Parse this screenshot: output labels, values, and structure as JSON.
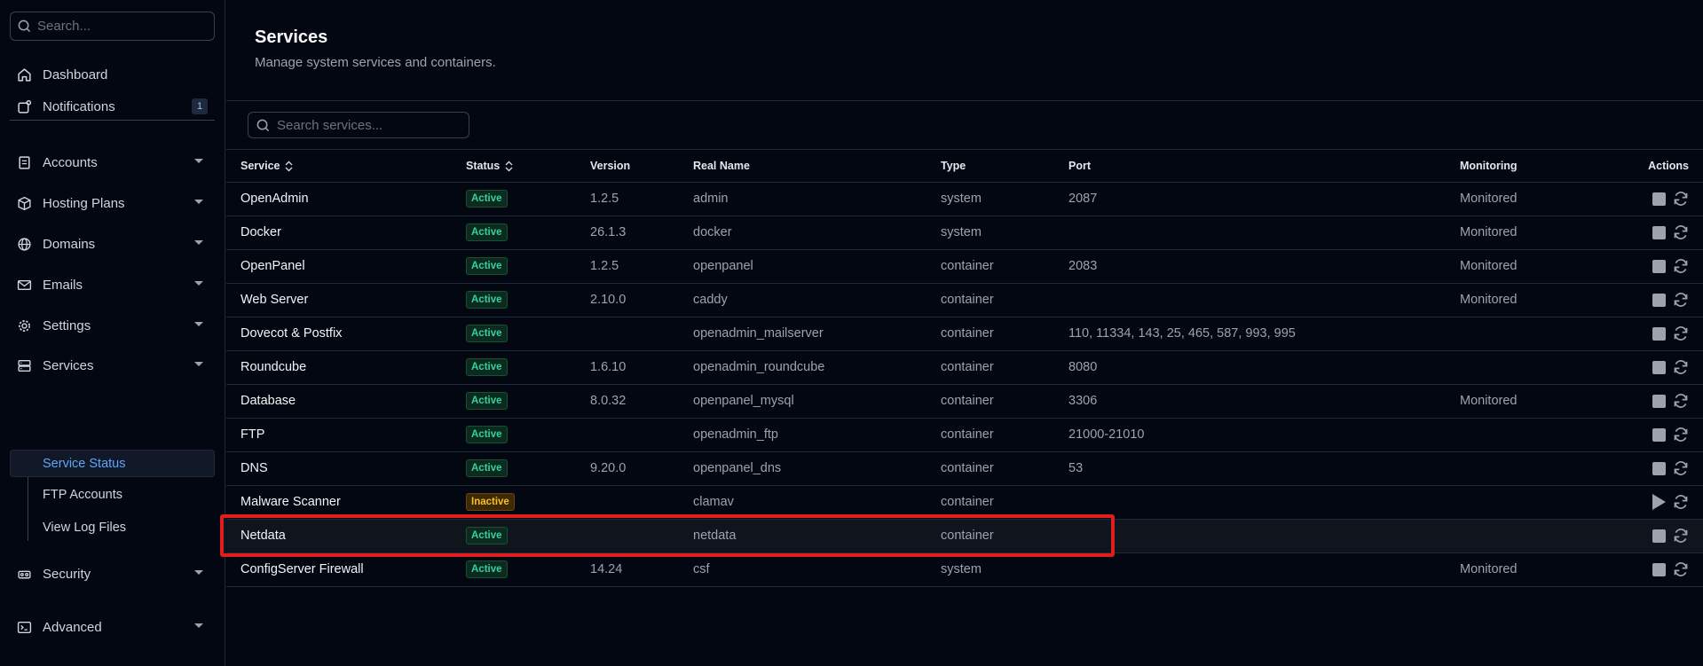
{
  "sidebar": {
    "search_placeholder": "Search...",
    "dashboard": "Dashboard",
    "notifications": "Notifications",
    "notifications_count": "1",
    "accounts": "Accounts",
    "hosting_plans": "Hosting Plans",
    "domains": "Domains",
    "emails": "Emails",
    "settings": "Settings",
    "services": "Services",
    "service_status": "Service Status",
    "ftp_accounts": "FTP Accounts",
    "view_log_files": "View Log Files",
    "security": "Security",
    "advanced": "Advanced"
  },
  "header": {
    "title": "Services",
    "subtitle": "Manage system services and containers."
  },
  "services_search_placeholder": "Search services...",
  "table": {
    "columns": {
      "service": "Service",
      "status": "Status",
      "version": "Version",
      "real_name": "Real Name",
      "type": "Type",
      "port": "Port",
      "monitoring": "Monitoring",
      "actions": "Actions"
    },
    "rows": [
      {
        "service": "OpenAdmin",
        "status": "Active",
        "version": "1.2.5",
        "real_name": "admin",
        "type": "system",
        "port": "2087",
        "monitoring": "Monitored"
      },
      {
        "service": "Docker",
        "status": "Active",
        "version": "26.1.3",
        "real_name": "docker",
        "type": "system",
        "port": "",
        "monitoring": "Monitored"
      },
      {
        "service": "OpenPanel",
        "status": "Active",
        "version": "1.2.5",
        "real_name": "openpanel",
        "type": "container",
        "port": "2083",
        "monitoring": "Monitored"
      },
      {
        "service": "Web Server",
        "status": "Active",
        "version": "2.10.0",
        "real_name": "caddy",
        "type": "container",
        "port": "",
        "monitoring": "Monitored"
      },
      {
        "service": "Dovecot & Postfix",
        "status": "Active",
        "version": "",
        "real_name": "openadmin_mailserver",
        "type": "container",
        "port": "110, 11334, 143, 25, 465, 587, 993, 995",
        "monitoring": ""
      },
      {
        "service": "Roundcube",
        "status": "Active",
        "version": "1.6.10",
        "real_name": "openadmin_roundcube",
        "type": "container",
        "port": "8080",
        "monitoring": ""
      },
      {
        "service": "Database",
        "status": "Active",
        "version": "8.0.32",
        "real_name": "openpanel_mysql",
        "type": "container",
        "port": "3306",
        "monitoring": "Monitored"
      },
      {
        "service": "FTP",
        "status": "Active",
        "version": "",
        "real_name": "openadmin_ftp",
        "type": "container",
        "port": "21000-21010",
        "monitoring": ""
      },
      {
        "service": "DNS",
        "status": "Active",
        "version": "9.20.0",
        "real_name": "openpanel_dns",
        "type": "container",
        "port": "53",
        "monitoring": ""
      },
      {
        "service": "Malware Scanner",
        "status": "Inactive",
        "version": "",
        "real_name": "clamav",
        "type": "container",
        "port": "",
        "monitoring": ""
      },
      {
        "service": "Netdata",
        "status": "Active",
        "version": "",
        "real_name": "netdata",
        "type": "container",
        "port": "",
        "monitoring": ""
      },
      {
        "service": "ConfigServer Firewall",
        "status": "Active",
        "version": "14.24",
        "real_name": "csf",
        "type": "system",
        "port": "",
        "monitoring": "Monitored"
      }
    ]
  },
  "colors": {
    "background": "#030712",
    "accent": "#60a5fa",
    "active_status": "#34d399",
    "inactive_status": "#fbbf24",
    "highlight_box": "#e11d1d"
  }
}
